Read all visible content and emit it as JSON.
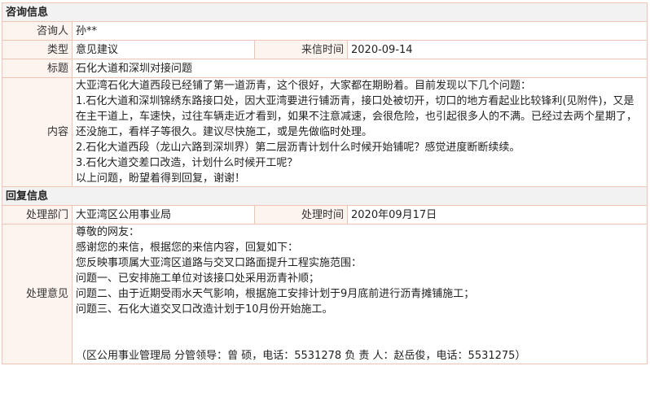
{
  "inquiry": {
    "section_title": "咨询信息",
    "asker_label": "咨询人",
    "asker_value": "孙**",
    "type_label": "类型",
    "type_value": "意见建议",
    "date_label": "来信时间",
    "date_value": "2020-09-14",
    "subject_label": "标题",
    "subject_value": "石化大道和深圳对接问题",
    "content_label": "内容",
    "content_lines": [
      "大亚湾石化大道西段已经铺了第一道沥青，这个很好，大家都在期盼着。目前发现以下几个问题：",
      "1.石化大道和深圳锦绣东路接口处，因大亚湾要进行铺沥青，接口处被切开，切口的地方看起业比较锋利(见附件)，又是在主干道上，车速快，过往车辆走近才看到，如果不注意减速，会很危险，也引起很多人的不满。已经过去两个星期了，还没施工，看样子等很久。建议尽快施工，或是先做临时处理。",
      "2.石化大道西段（龙山六路到深圳界）第二层沥青计划什么时候开始铺呢？感觉进度断断续续。",
      "3.石化大道交差口改造，计划什么时候开工呢？",
      "以上问题，盼望着得到回复，谢谢！"
    ]
  },
  "reply": {
    "section_title": "回复信息",
    "dept_label": "处理部门",
    "dept_value": "大亚湾区公用事业局",
    "time_label": "处理时间",
    "time_value": "2020年09月17日",
    "opinion_label": "处理意见",
    "opinion_lines": [
      "尊敬的网友：",
      "感谢您的来信，根据您的来信内容，回复如下：",
      "您反映事项属大亚湾区道路与交叉口路面提升工程实施范围：",
      "问题一、已安排施工单位对该接口处采用沥青补顺；",
      "问题二、由于近期受雨水天气影响，根据施工安排计划于9月底前进行沥青摊铺施工；",
      "问题三、石化大道交叉口改造计划于10月份开始施工。"
    ],
    "signature": "（区公用事业管理局 分管领导：曾 硕，电话：5531278 负 责 人：赵岳俊，电话：5531275）"
  }
}
